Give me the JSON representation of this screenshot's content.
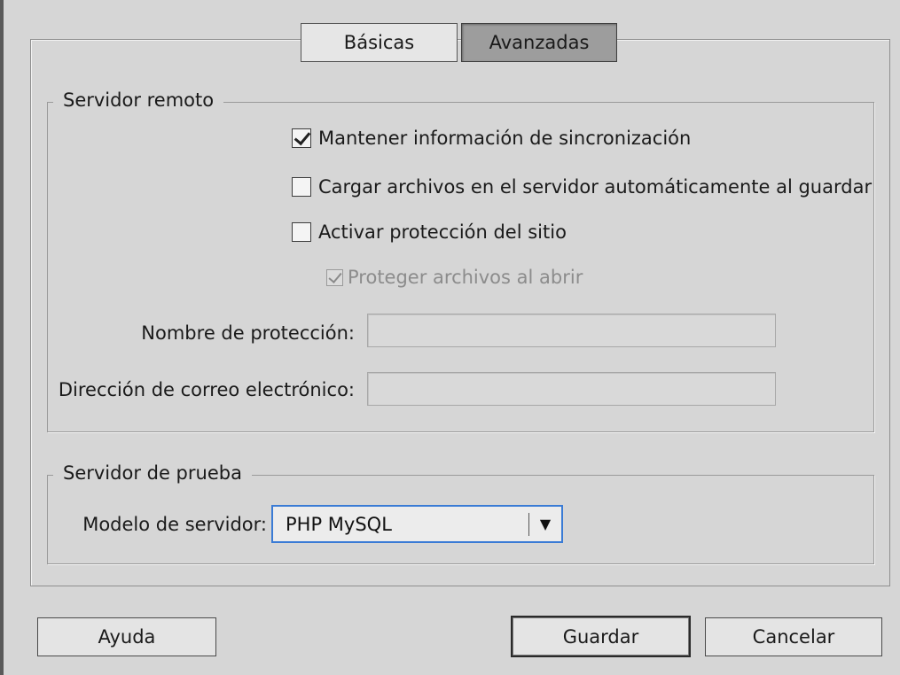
{
  "tabs": [
    {
      "label": "Básicas",
      "selected": false
    },
    {
      "label": "Avanzadas",
      "selected": true
    }
  ],
  "remote_server": {
    "legend": "Servidor remoto",
    "checkboxes": [
      {
        "label": "Mantener información de sincronización",
        "checked": true,
        "enabled": true
      },
      {
        "label": "Cargar archivos en el servidor automáticamente al guardar",
        "checked": false,
        "enabled": true
      },
      {
        "label": "Activar protección del sitio",
        "checked": false,
        "enabled": true
      },
      {
        "label": "Proteger archivos al abrir",
        "checked": true,
        "enabled": false
      }
    ],
    "checkout_name_label": "Nombre de protección:",
    "checkout_name_value": "",
    "email_label": "Dirección de correo electrónico:",
    "email_value": ""
  },
  "testing_server": {
    "legend": "Servidor de prueba",
    "server_model_label": "Modelo de servidor:",
    "server_model_value": "PHP MySQL"
  },
  "buttons": {
    "help": "Ayuda",
    "save": "Guardar",
    "cancel": "Cancelar"
  },
  "icons": {
    "dropdown": "chevron-down-icon",
    "checkbox": "checkmark-icon"
  },
  "colors": {
    "dialog_bg": "#d6d6d6",
    "select_focus": "#3a7bd5",
    "selected_tab": "#9d9d9d"
  }
}
